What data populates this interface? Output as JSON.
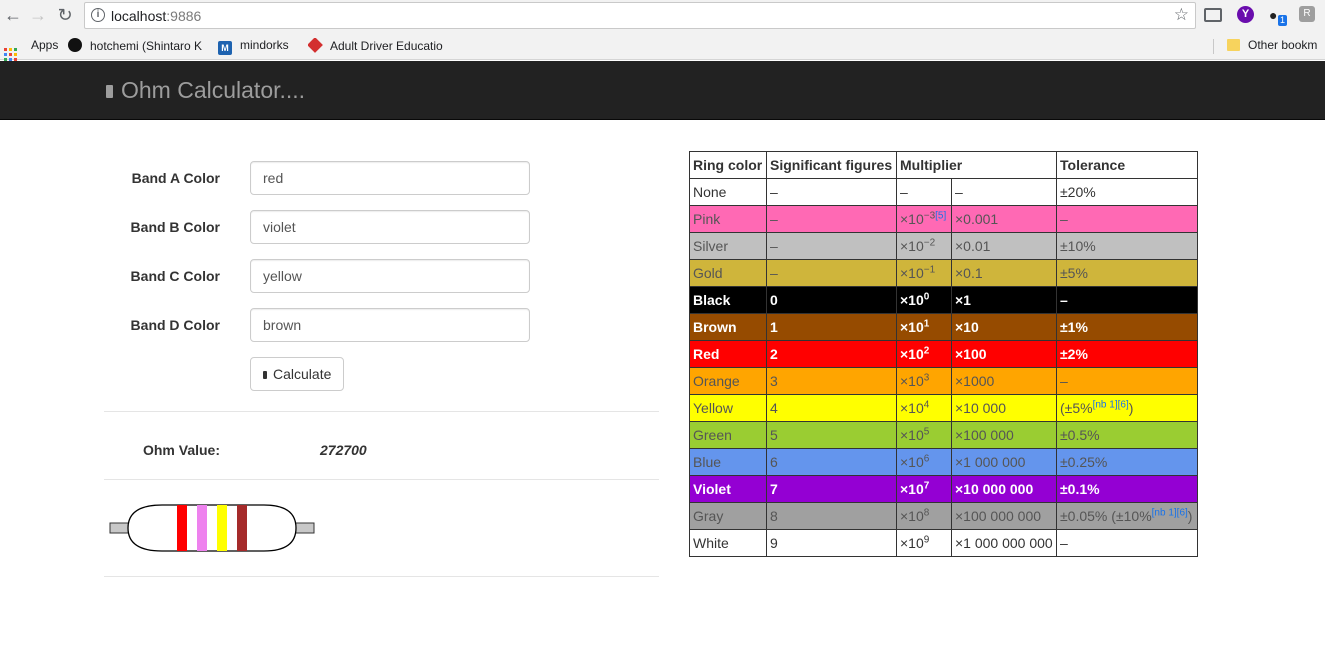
{
  "browser": {
    "url_host": "localhost",
    "url_port": ":9886",
    "bookmarks": [
      {
        "label": "Apps",
        "icon": "apps-grid-icon"
      },
      {
        "label": "hotchemi (Shintaro K",
        "icon": "github-icon"
      },
      {
        "label": "mindorks",
        "icon": "mindorks-icon"
      },
      {
        "label": "Adult Driver Educatio",
        "icon": "driver-ed-icon"
      }
    ],
    "other_bookmarks": "Other bookm",
    "extension_y": "Y",
    "extension_badge": "1",
    "extension_r": "R"
  },
  "navbar": {
    "brand": "Ohm Calculator...."
  },
  "form": {
    "fields": [
      {
        "label": "Band A Color",
        "value": "red"
      },
      {
        "label": "Band B Color",
        "value": "violet"
      },
      {
        "label": "Band C Color",
        "value": "yellow"
      },
      {
        "label": "Band D Color",
        "value": "brown"
      }
    ],
    "calculate_label": "Calculate"
  },
  "result": {
    "label": "Ohm Value:",
    "value": "272700"
  },
  "resistor": {
    "body_color": "#ffffff",
    "bands": [
      "#ff0000",
      "#ee82ee",
      "#ffff00",
      "#a52a2a"
    ]
  },
  "table": {
    "headers": [
      "Ring color",
      "Significant figures",
      "Multiplier",
      "Tolerance"
    ],
    "rows": [
      {
        "color": "None",
        "sig": "–",
        "mult_exp": "–",
        "mult": "–",
        "tol": "±20%",
        "bg": "#ffffff",
        "style": "plain"
      },
      {
        "color": "Pink",
        "sig": "–",
        "mult_exp": "×10−3",
        "mult_ref": "[5]",
        "mult": "×0.001",
        "tol": "–",
        "bg": "#ff69b4",
        "style": "light"
      },
      {
        "color": "Silver",
        "sig": "–",
        "mult_exp": "×10−2",
        "mult": "×0.01",
        "tol": "±10%",
        "bg": "#c0c0c0",
        "style": "light"
      },
      {
        "color": "Gold",
        "sig": "–",
        "mult_exp": "×10−1",
        "mult": "×0.1",
        "tol": "±5%",
        "bg": "#cfb53b",
        "style": "light"
      },
      {
        "color": "Black",
        "sig": "0",
        "mult_exp": "×100",
        "mult": "×1",
        "tol": "–",
        "bg": "#000000",
        "style": "white"
      },
      {
        "color": "Brown",
        "sig": "1",
        "mult_exp": "×101",
        "mult": "×10",
        "tol": "±1%",
        "bg": "#964b00",
        "style": "white"
      },
      {
        "color": "Red",
        "sig": "2",
        "mult_exp": "×102",
        "mult": "×100",
        "tol": "±2%",
        "bg": "#ff0000",
        "style": "white"
      },
      {
        "color": "Orange",
        "sig": "3",
        "mult_exp": "×103",
        "mult": "×1000",
        "tol": "–",
        "bg": "#ffa500",
        "style": "light"
      },
      {
        "color": "Yellow",
        "sig": "4",
        "mult_exp": "×104",
        "mult": "×10 000",
        "tol": "(±5%",
        "tol_ref": "[nb 1][6]",
        "tol_suffix": ")",
        "bg": "#ffff00",
        "style": "light"
      },
      {
        "color": "Green",
        "sig": "5",
        "mult_exp": "×105",
        "mult": "×100 000",
        "tol": "±0.5%",
        "bg": "#9acd32",
        "style": "light"
      },
      {
        "color": "Blue",
        "sig": "6",
        "mult_exp": "×106",
        "mult": "×1 000 000",
        "tol": "±0.25%",
        "bg": "#6495ed",
        "style": "light"
      },
      {
        "color": "Violet",
        "sig": "7",
        "mult_exp": "×107",
        "mult": "×10 000 000",
        "tol": "±0.1%",
        "bg": "#9400d3",
        "style": "white"
      },
      {
        "color": "Gray",
        "sig": "8",
        "mult_exp": "×108",
        "mult": "×100 000 000",
        "tol": "±0.05% (±10%",
        "tol_ref": "[nb 1][6]",
        "tol_suffix": ")",
        "bg": "#a0a0a0",
        "style": "light"
      },
      {
        "color": "White",
        "sig": "9",
        "mult_exp": "×109",
        "mult": "×1 000 000 000",
        "tol": "–",
        "bg": "#ffffff",
        "style": "plain"
      }
    ]
  }
}
